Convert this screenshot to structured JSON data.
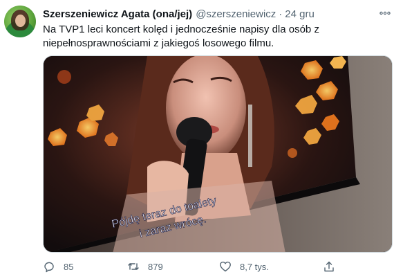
{
  "tweet": {
    "author_name": "Szerszeniewicz Agata (ona/jej)",
    "handle": "@szerszeniewicz",
    "separator": "·",
    "date": "24 gru",
    "text_line1": "Na TVP1 leci koncert kolęd i jednocześnie napisy dla osób z",
    "text_line2": "niepełnosprawnościami z jakiegoś losowego filmu.",
    "media": {
      "subtitle_line1": "Pójdę teraz do toalety",
      "subtitle_line2": "i zaraz wrócę."
    },
    "actions": {
      "replies": "85",
      "retweets": "879",
      "likes": "8,7 tys."
    }
  },
  "icons": {
    "more": "more-horizontal-icon",
    "reply": "reply-icon",
    "retweet": "retweet-icon",
    "like": "heart-icon",
    "share": "share-icon"
  },
  "colors": {
    "text": "#0f1419",
    "secondary": "#536471",
    "border": "#cfd9de"
  }
}
